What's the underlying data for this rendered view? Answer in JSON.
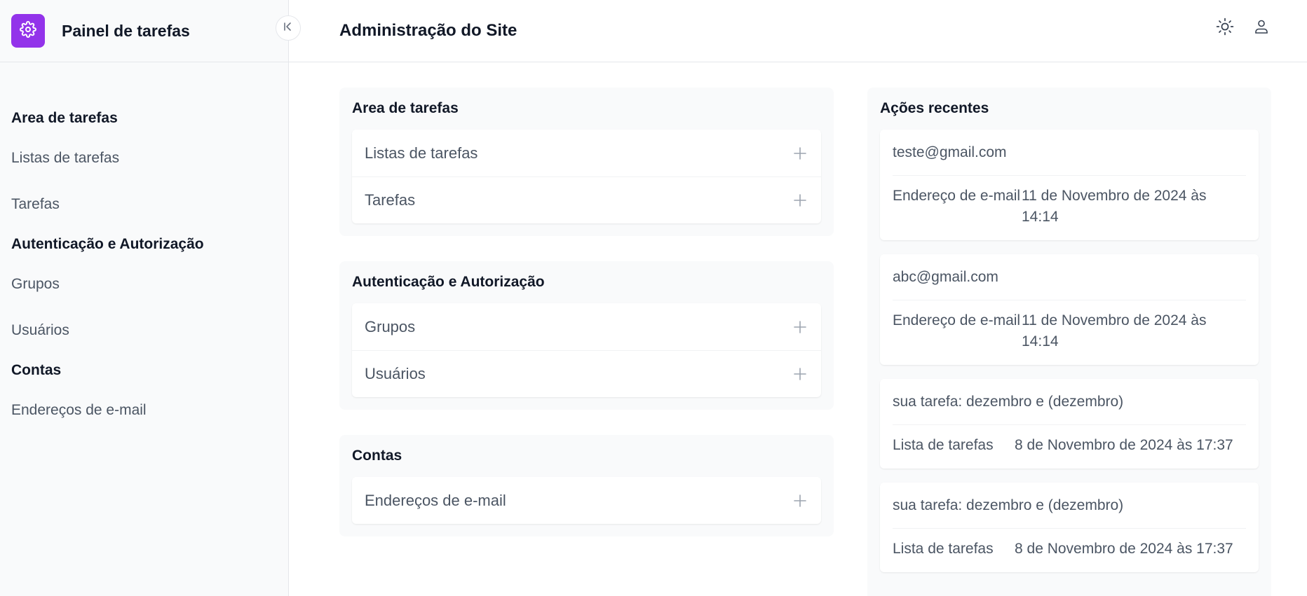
{
  "sidebar": {
    "title": "Painel de tarefas",
    "sections": [
      {
        "title": "Area de tarefas",
        "items": [
          {
            "label": "Listas de tarefas"
          },
          {
            "label": "Tarefas"
          }
        ]
      },
      {
        "title": "Autenticação e Autorização",
        "items": [
          {
            "label": "Grupos"
          },
          {
            "label": "Usuários"
          }
        ]
      },
      {
        "title": "Contas",
        "items": [
          {
            "label": "Endereços de e-mail"
          }
        ]
      }
    ]
  },
  "header": {
    "title": "Administração do Site"
  },
  "apps": [
    {
      "title": "Area de tarefas",
      "models": [
        {
          "label": "Listas de tarefas"
        },
        {
          "label": "Tarefas"
        }
      ]
    },
    {
      "title": "Autenticação e Autorização",
      "models": [
        {
          "label": "Grupos"
        },
        {
          "label": "Usuários"
        }
      ]
    },
    {
      "title": "Contas",
      "models": [
        {
          "label": "Endereços de e-mail"
        }
      ]
    }
  ],
  "recent": {
    "title": "Ações recentes",
    "actions": [
      {
        "name": "teste@gmail.com",
        "type": "Endereço de e-mail",
        "date": "11 de Novembro de 2024 às 14:14"
      },
      {
        "name": "abc@gmail.com",
        "type": "Endereço de e-mail",
        "date": "11 de Novembro de 2024 às 14:14"
      },
      {
        "name": "sua tarefa: dezembro e (dezembro)",
        "type": "Lista de tarefas",
        "date": "8 de Novembro de 2024 às 17:37"
      },
      {
        "name": "sua tarefa: dezembro e (dezembro)",
        "type": "Lista de tarefas",
        "date": "8 de Novembro de 2024 às 17:37"
      }
    ]
  },
  "colors": {
    "accent": "#9333ea",
    "sidebar_bg": "#f9fafb",
    "text_muted": "#4b5563"
  },
  "icons": [
    "gear-icon",
    "collapse-icon",
    "sun-icon",
    "user-icon",
    "plus-icon"
  ]
}
